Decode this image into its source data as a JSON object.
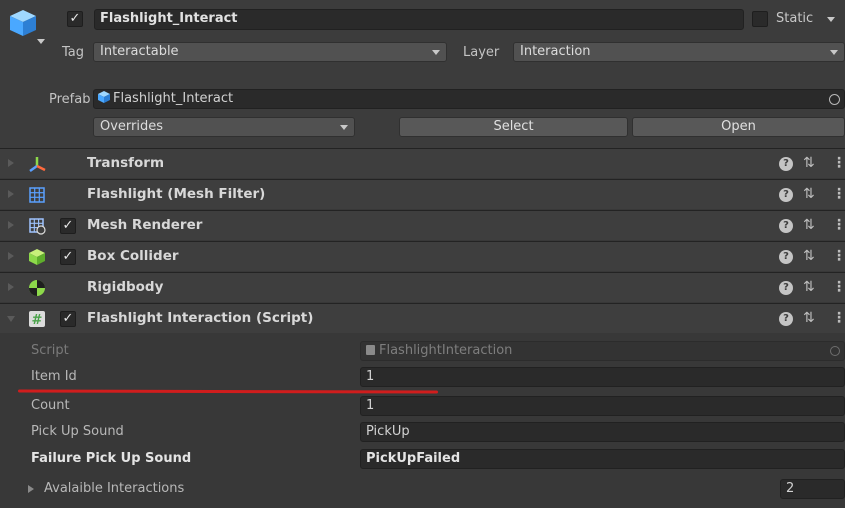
{
  "gameobject": {
    "name": "Flashlight_Interact",
    "active": true,
    "static_label": "Static",
    "tag_label": "Tag",
    "tag_value": "Interactable",
    "layer_label": "Layer",
    "layer_value": "Interaction"
  },
  "prefab": {
    "label": "Prefab",
    "asset": "Flashlight_Interact",
    "overrides_label": "Overrides",
    "select_label": "Select",
    "open_label": "Open"
  },
  "components": [
    {
      "title": "Transform",
      "icon": "transform-axes-icon",
      "has_checkbox": false,
      "expanded": false
    },
    {
      "title": "Flashlight (Mesh Filter)",
      "icon": "mesh-filter-grid-icon",
      "has_checkbox": false,
      "expanded": false
    },
    {
      "title": "Mesh Renderer",
      "icon": "mesh-renderer-icon",
      "has_checkbox": true,
      "enabled": true,
      "expanded": false
    },
    {
      "title": "Box Collider",
      "icon": "box-collider-cube-icon",
      "has_checkbox": true,
      "enabled": true,
      "expanded": false
    },
    {
      "title": "Rigidbody",
      "icon": "rigidbody-sphere-icon",
      "has_checkbox": false,
      "expanded": false
    },
    {
      "title": "Flashlight Interaction (Script)",
      "icon": "script-hash-icon",
      "has_checkbox": true,
      "enabled": true,
      "expanded": true
    }
  ],
  "script_fields": {
    "script_label": "Script",
    "script_value": "FlashlightInteraction",
    "item_id_label": "Item Id",
    "item_id_value": "1",
    "count_label": "Count",
    "count_value": "1",
    "pickup_sound_label": "Pick Up Sound",
    "pickup_sound_value": "PickUp",
    "failure_sound_label": "Failure Pick Up Sound",
    "failure_sound_value": "PickUpFailed",
    "interactions_label": "Avalaible Interactions",
    "interactions_count": "2"
  },
  "colors": {
    "panel_bg": "#383838",
    "header_bg": "#3e3e3e",
    "field_bg": "#2a2a2a",
    "annotation_underline": "#d01d1d",
    "prefab_blue": "#4aa8ff"
  }
}
